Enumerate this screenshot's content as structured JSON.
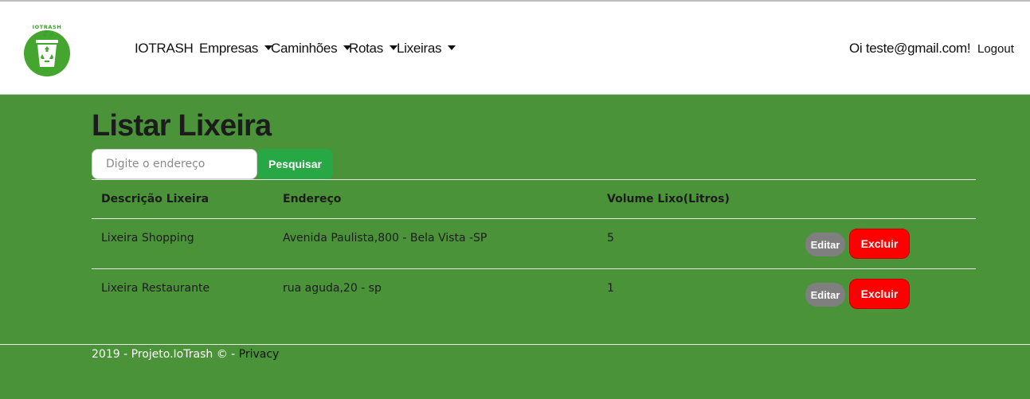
{
  "navbar": {
    "logo_text": "IOTRASH",
    "brand": "IOTRASH",
    "menus": [
      {
        "label": "Empresas"
      },
      {
        "label": "Caminhões"
      },
      {
        "label": "Rotas"
      },
      {
        "label": "Lixeiras"
      }
    ],
    "greeting": "Oi teste@gmail.com!",
    "logout": "Logout"
  },
  "page": {
    "title": "Listar Lixeira"
  },
  "search": {
    "placeholder": "Digite o endereço",
    "value": "",
    "button": "Pesquisar"
  },
  "table": {
    "headers": [
      "Descrição Lixeira",
      "Endereço",
      "Volume Lixo(Litros)"
    ],
    "rows": [
      {
        "descricao": "Lixeira Shopping",
        "endereco": "Avenida Paulista,800 - Bela Vista -SP",
        "volume": "5",
        "edit": "Editar",
        "delete": "Excluir"
      },
      {
        "descricao": "Lixeira Restaurante",
        "endereco": "rua aguda,20 - sp",
        "volume": "1",
        "edit": "Editar",
        "delete": "Excluir"
      }
    ]
  },
  "footer": {
    "text": "2019 - Projeto.IoTrash © - ",
    "link": "Privacy"
  },
  "colors": {
    "background": "#4a9338",
    "search_button": "#28a745",
    "edit_button": "#7f7f7f",
    "delete_button": "#ff0000"
  },
  "icons": [
    "recycle-bin-logo-icon",
    "caret-down-icon"
  ]
}
